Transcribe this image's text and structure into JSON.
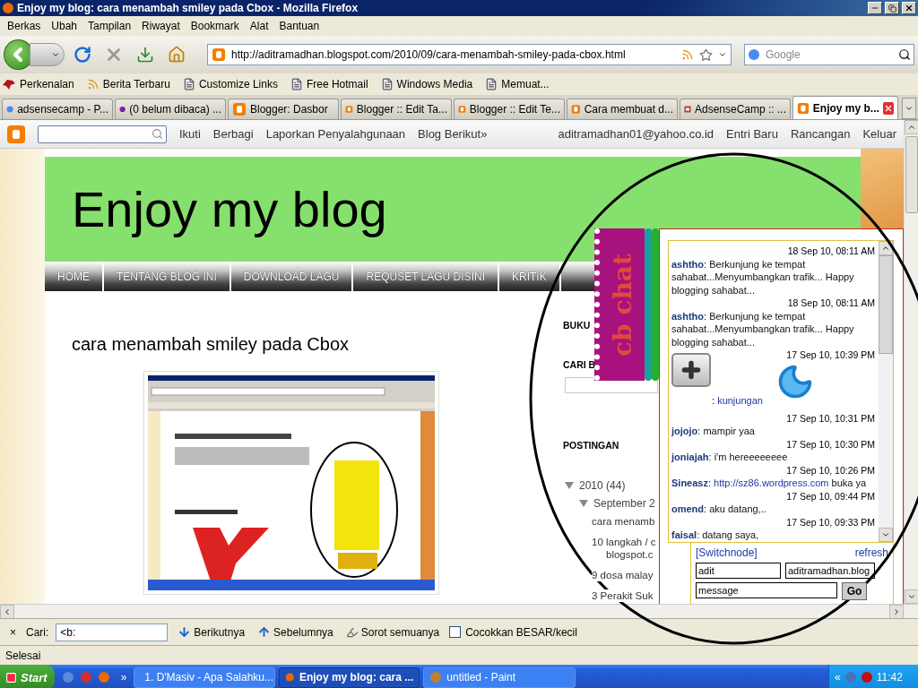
{
  "window": {
    "title": "Enjoy my blog: cara menambah smiley pada Cbox - Mozilla Firefox"
  },
  "menu": [
    "Berkas",
    "Ubah",
    "Tampilan",
    "Riwayat",
    "Bookmark",
    "Alat",
    "Bantuan"
  ],
  "address": {
    "value": "http://aditramadhan.blogspot.com/2010/09/cara-menambah-smiley-pada-cbox.html"
  },
  "search": {
    "placeholder": "Google"
  },
  "bookmarks": [
    {
      "label": "Perkenalan",
      "kind": "bird"
    },
    {
      "label": "Berita Terbaru",
      "kind": "feed"
    },
    {
      "label": "Customize Links",
      "kind": "page"
    },
    {
      "label": "Free Hotmail",
      "kind": "page"
    },
    {
      "label": "Windows Media",
      "kind": "page"
    },
    {
      "label": "Memuat...",
      "kind": "page"
    }
  ],
  "tabs": [
    {
      "label": "adsensecamp - P...",
      "selected": false,
      "kind": "google"
    },
    {
      "label": "(0 belum dibaca) ...",
      "selected": false,
      "kind": "yahoo"
    },
    {
      "label": "Blogger: Dasbor",
      "selected": false,
      "kind": "blogger"
    },
    {
      "label": "Blogger :: Edit Ta...",
      "selected": false,
      "kind": "blogger"
    },
    {
      "label": "Blogger :: Edit Te...",
      "selected": false,
      "kind": "blogger"
    },
    {
      "label": "Cara membuat d...",
      "selected": false,
      "kind": "blogger"
    },
    {
      "label": "AdsenseCamp :: ...",
      "selected": false,
      "kind": "ad"
    },
    {
      "label": "Enjoy my b...",
      "selected": true,
      "kind": "blogger"
    }
  ],
  "blogger_bar": {
    "links": [
      "Ikuti",
      "Berbagi",
      "Laporkan Penyalahgunaan",
      "Blog Berikut»"
    ],
    "account": "aditramadhan01@yahoo.co.id",
    "actions": [
      "Entri Baru",
      "Rancangan",
      "Keluar"
    ]
  },
  "blog": {
    "title": "Enjoy my blog",
    "nav": [
      "HOME",
      "TENTANG BLOG INI",
      "DOWNLOAD LAGU",
      "REQUSET LAGU DISINI",
      "KRITIK"
    ],
    "post_title": "cara menambah smiley pada Cbox"
  },
  "sidebar": [
    {
      "kind": "heading",
      "text": "BUKU"
    },
    {
      "kind": "heading",
      "text": "CARI B"
    },
    {
      "kind": "search"
    },
    {
      "kind": "heading",
      "text": "POSTINGAN"
    },
    {
      "kind": "year",
      "text": "2010",
      "count": "(44)",
      "expanded": true
    },
    {
      "kind": "month",
      "text": "September 2",
      "expanded": true
    },
    {
      "kind": "post",
      "lines": [
        "cara menamb"
      ]
    },
    {
      "kind": "post",
      "lines": [
        "10 langkah / c",
        "blogspot.c"
      ]
    },
    {
      "kind": "post",
      "lines": [
        "9 dosa malay"
      ]
    },
    {
      "kind": "post",
      "lines": [
        "3 Perakit Suk"
      ]
    }
  ],
  "chat": {
    "logo": "cb chat",
    "messages": [
      {
        "kind": "text",
        "time": "18 Sep 10, 08:11 AM",
        "name": "ashtho",
        "text": ": Berkunjung ke tempat sahabat...Menyumbangkan trafik... Happy blogging sahabat..."
      },
      {
        "kind": "text",
        "time": "18 Sep 10, 08:11 AM",
        "name": "ashtho",
        "text": ": Berkunjung ke tempat sahabat...Menyumbangkan trafik... Happy blogging sahabat..."
      },
      {
        "kind": "smiley",
        "time": "17 Sep 10, 10:39 PM",
        "text": ":",
        "link": "kunjungan"
      },
      {
        "kind": "text",
        "time": "17 Sep 10, 10:31 PM",
        "name": "jojojo",
        "text": ": mampir yaa"
      },
      {
        "kind": "text",
        "time": "17 Sep 10, 10:30 PM",
        "name": "joniajah",
        "text": ": i'm hereeeeeeee"
      },
      {
        "kind": "text",
        "time": "17 Sep 10, 10:26 PM",
        "name": "Sineasz",
        "text": ":",
        "link": "http://sz86.wordpress.com",
        "after": "buka ya"
      },
      {
        "kind": "text",
        "time": "17 Sep 10, 09:44 PM",
        "name": "omend",
        "text": ": aku datang,.."
      },
      {
        "kind": "text",
        "time": "17 Sep 10, 09:33 PM",
        "name": "faisal",
        "text": ": datang saya,"
      }
    ],
    "switch": "[Switchnode]",
    "refresh": "refresh",
    "name": "adit",
    "url": "aditramadhan.blog",
    "message": "message",
    "go": "Go"
  },
  "find_bar": {
    "close": "×",
    "label": "Cari:",
    "value": "<b:",
    "buttons": [
      {
        "label": "Berikutnya",
        "kind": "next"
      },
      {
        "label": "Sebelumnya",
        "kind": "prev"
      },
      {
        "label": "Sorot semuanya",
        "kind": "highlight"
      }
    ],
    "match_case": {
      "label": "Cocokkan BESAR/kecil",
      "checked": false
    }
  },
  "status_bar": "Selesai",
  "taskbar": {
    "start": "Start",
    "chevron": "»",
    "tasks": [
      {
        "label": "1. D'Masiv - Apa Salahku...",
        "selected": false,
        "kind": "media"
      },
      {
        "label": "Enjoy my blog: cara ...",
        "selected": true,
        "kind": "browser"
      },
      {
        "label": "untitled - Paint",
        "selected": false,
        "kind": "paint"
      }
    ],
    "tray_chevron": "«",
    "clock": "11:42"
  }
}
